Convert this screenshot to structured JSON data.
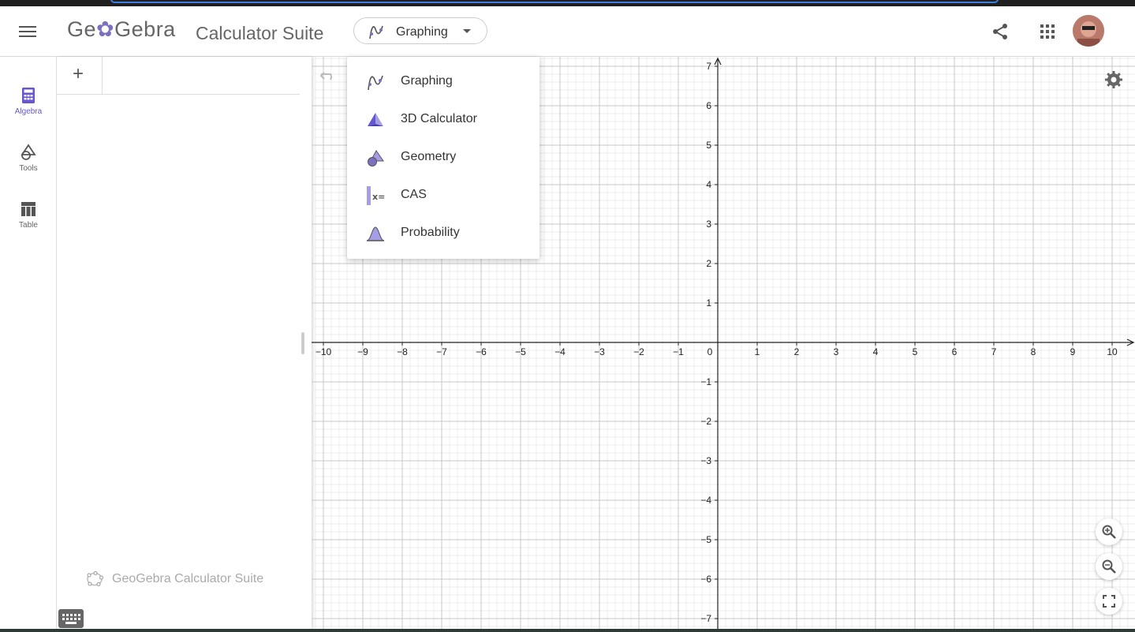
{
  "header": {
    "logo": "GeoGebra",
    "title": "Calculator Suite",
    "app_selector": {
      "selected": "Graphing"
    }
  },
  "sidebar": {
    "items": [
      {
        "label": "Algebra",
        "icon": "calculator-icon",
        "active": true
      },
      {
        "label": "Tools",
        "icon": "tools-shapes-icon",
        "active": false
      },
      {
        "label": "Table",
        "icon": "table-icon",
        "active": false
      }
    ]
  },
  "algebra": {
    "add_label": "+",
    "brand": "GeoGebra Calculator Suite"
  },
  "dropdown": {
    "items": [
      {
        "label": "Graphing",
        "icon": "graphing-icon"
      },
      {
        "label": "3D Calculator",
        "icon": "3d-calculator-icon"
      },
      {
        "label": "Geometry",
        "icon": "geometry-icon"
      },
      {
        "label": "CAS",
        "icon": "cas-icon"
      },
      {
        "label": "Probability",
        "icon": "probability-icon"
      }
    ]
  },
  "graph": {
    "x_ticks": [
      "−10",
      "−9",
      "−8",
      "−7",
      "−6",
      "−5",
      "−4",
      "−3",
      "−2",
      "−1",
      "0",
      "1",
      "2",
      "3",
      "4",
      "5",
      "6",
      "7",
      "8",
      "9",
      "10"
    ],
    "y_ticks": [
      "7",
      "6",
      "5",
      "4",
      "3",
      "2",
      "1",
      "−1",
      "−2",
      "−3",
      "−4",
      "−5",
      "−6",
      "−7"
    ],
    "x_range": [
      -10,
      10
    ],
    "y_range": [
      -7,
      7
    ]
  },
  "colors": {
    "accent": "#6557d2",
    "icon_purple": "#7d6fbf",
    "grid_major": "#c8c8c8",
    "grid_minor": "#ececec"
  }
}
